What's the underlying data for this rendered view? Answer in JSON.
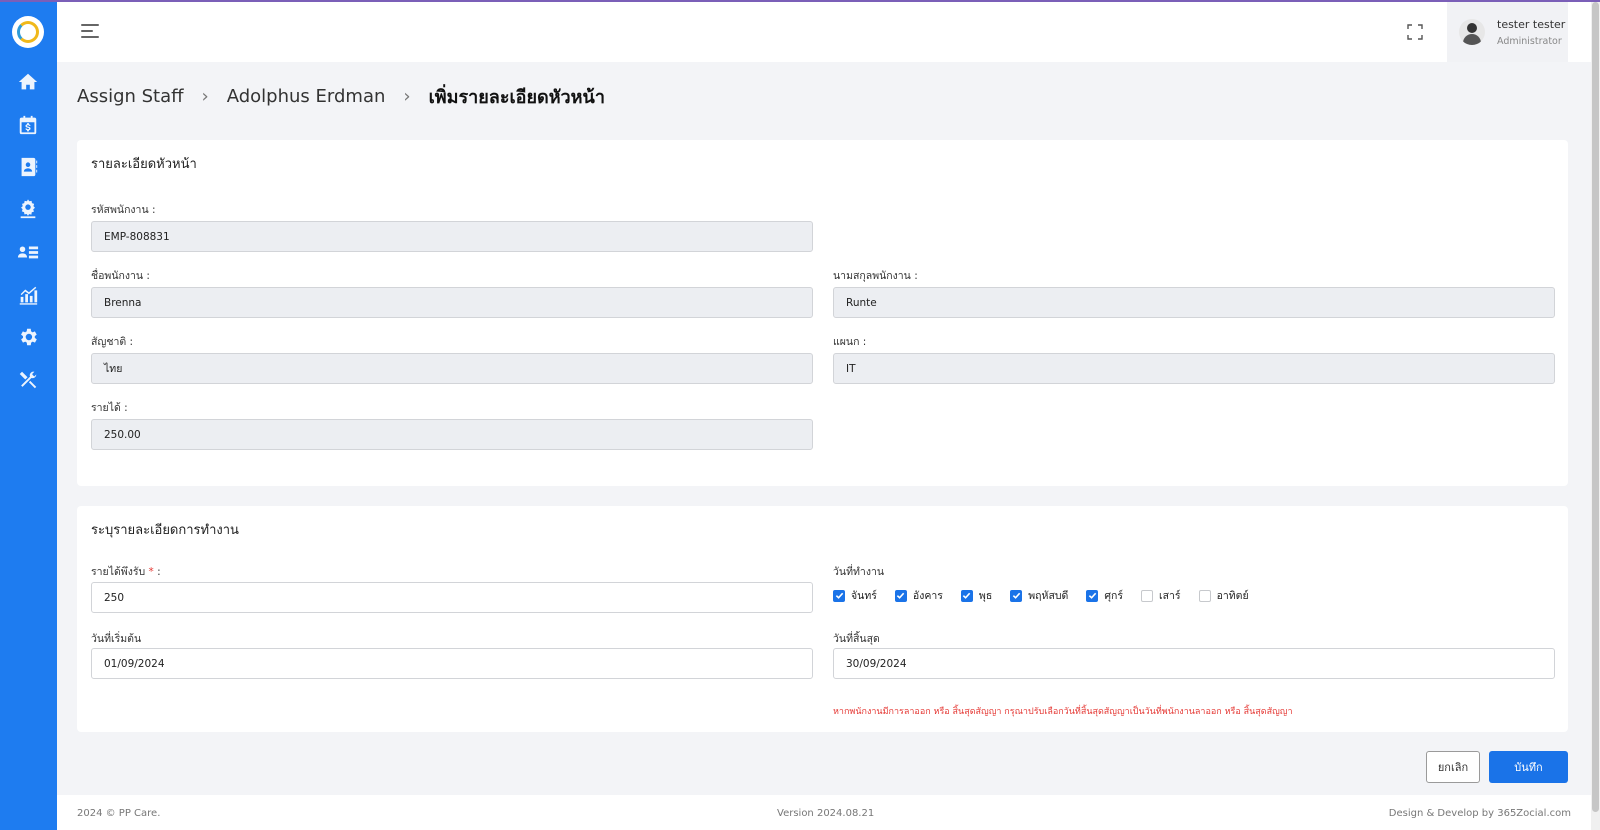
{
  "user": {
    "name": "tester tester",
    "role": "Administrator"
  },
  "sidebar": {
    "icons": [
      "home-icon",
      "calendar-dollar-icon",
      "contact-book-icon",
      "users-gear-icon",
      "staff-list-icon",
      "chart-icon",
      "settings-icon",
      "tools-icon"
    ]
  },
  "breadcrumb": {
    "item1": "Assign Staff",
    "item2": "Adolphus Erdman",
    "current": "เพิ่มรายละเอียดหัวหน้า"
  },
  "detail": {
    "title": "รายละเอียดหัวหน้า",
    "employee_id_label": "รหัสพนักงาน :",
    "employee_id": "EMP-808831",
    "first_name_label": "ชื่อพนักงาน :",
    "first_name": "Brenna",
    "last_name_label": "นามสกุลพนักงาน :",
    "last_name": "Runte",
    "nationality_label": "สัญชาติ :",
    "nationality": "ไทย",
    "department_label": "แผนก :",
    "department": "IT",
    "income_label": "รายได้ :",
    "income": "250.00"
  },
  "work": {
    "title": "ระบุรายละเอียดการทำงาน",
    "expected_income_label": "รายได้พึงรับ",
    "expected_income_colon": " :",
    "required_mark": "*",
    "expected_income": "250",
    "work_days_label": "วันที่ทำงาน",
    "days": [
      {
        "label": "จันทร์",
        "checked": true
      },
      {
        "label": "อังคาร",
        "checked": true
      },
      {
        "label": "พุธ",
        "checked": true
      },
      {
        "label": "พฤหัสบดี",
        "checked": true
      },
      {
        "label": "ศุกร์",
        "checked": true
      },
      {
        "label": "เสาร์",
        "checked": false
      },
      {
        "label": "อาทิตย์",
        "checked": false
      }
    ],
    "start_date_label": "วันที่เริ่มต้น",
    "start_date": "01/09/2024",
    "end_date_label": "วันที่สิ้นสุด",
    "end_date": "30/09/2024",
    "warning": "หากพนักงานมีการลาออก หรือ สิ้นสุดสัญญา กรุณาปรับเลือกวันที่สิ้นสุดสัญญาเป็นวันที่พนักงานลาออก หรือ สิ้นสุดสัญญา"
  },
  "actions": {
    "cancel": "ยกเลิก",
    "save": "บันทึก"
  },
  "footer": {
    "copyright": "2024 © PP Care.",
    "version": "Version 2024.08.21",
    "credit": "Design & Develop by 365Zocial.com"
  },
  "colors": {
    "sidebar": "#1e7cf0",
    "primary": "#1a73e8",
    "danger": "#e53935"
  }
}
